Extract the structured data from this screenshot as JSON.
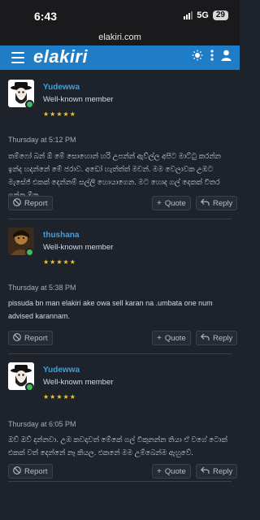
{
  "status_bar": {
    "time": "6:43",
    "network": "5G",
    "battery": "29"
  },
  "browser": {
    "url": "elakiri.com"
  },
  "header": {
    "logo": "elakiri",
    "icons": [
      "menu-icon",
      "theme-icon",
      "more-vertical-icon",
      "user-icon"
    ],
    "colors": {
      "bar": "#1f7cc7"
    }
  },
  "posts": [
    {
      "username": "Yudewwa",
      "role": "Well-known member",
      "stars": "★★★★★",
      "date": "Thursday at 5:12 PM",
      "body": "තම්ෆෝ බන් ඕ මේ සොහොන් හරි උපන්න් ඇව්ල්ල අපිට මාට්ටු කරන්න ඉන්ද හදන්නේ මේ ජරාව. අඩෝ හැත්ත්ත් මචන්. මම වෙලාවක උඹට මැසේජ් එකක් දෙන්නම් සල්ලි හොයාගෙන. මට හොද ගල් දෙකක් විතර ගන්න ඕන.",
      "actions": {
        "report": "Report",
        "quote": "Quote",
        "reply": "Reply"
      }
    },
    {
      "username": "thushana",
      "role": "Well-known member",
      "stars": "★★★★★",
      "date": "Thursday at 5:38 PM",
      "body": "pissuda bn man elakiri ake owa sell karan na .umbata one num advised karannam.",
      "actions": {
        "report": "Report",
        "quote": "Quote",
        "reply": "Reply"
      }
    },
    {
      "username": "Yudewwa",
      "role": "Well-known member",
      "stars": "★★★★★",
      "date": "Thursday at 6:05 PM",
      "body": "ඔව් ඔව් දන්නවා. උඹ කවදාවත් මේකේ ගල් විකුනන්න තියා ඒ වගේ ටොක් එකක් වත් දෙන්නේ නෑ කියල. එකනේ මම උම්බෙන්ම ඇහුවේ.",
      "actions": {
        "report": "Report",
        "quote": "Quote",
        "reply": "Reply"
      }
    }
  ]
}
